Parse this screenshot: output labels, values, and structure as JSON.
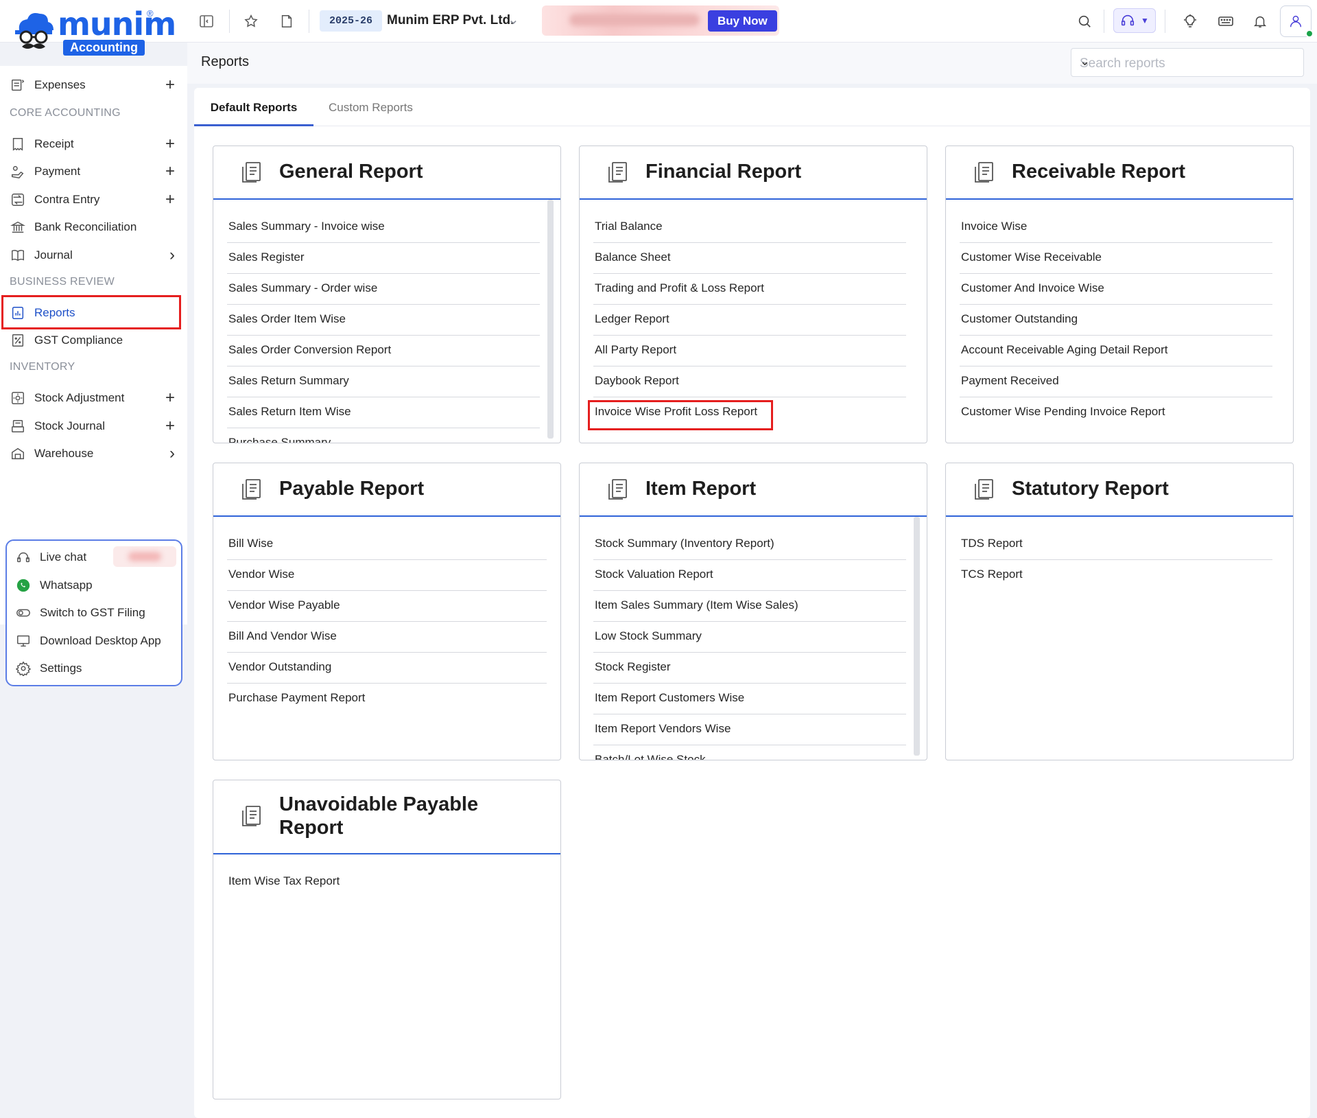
{
  "brand": {
    "name": "munim",
    "registered": "®",
    "tag": "Accounting"
  },
  "topbar": {
    "fiscal_year": "2025-26",
    "company": "Munim ERP Pvt. Ltd.",
    "buy_now": "Buy Now"
  },
  "sidebar": {
    "items": [
      {
        "label": "Expenses",
        "icon": "expenses-icon",
        "trail": "+"
      },
      {
        "label": "Receipt",
        "icon": "receipt-icon",
        "trail": "+"
      },
      {
        "label": "Payment",
        "icon": "payment-icon",
        "trail": "+"
      },
      {
        "label": "Contra Entry",
        "icon": "contra-icon",
        "trail": "+"
      },
      {
        "label": "Bank Reconciliation",
        "icon": "bank-icon",
        "trail": ""
      },
      {
        "label": "Journal",
        "icon": "journal-icon",
        "trail": "›"
      },
      {
        "label": "Reports",
        "icon": "reports-icon",
        "trail": ""
      },
      {
        "label": "GST Compliance",
        "icon": "gst-icon",
        "trail": ""
      },
      {
        "label": "Stock Adjustment",
        "icon": "stock-adjust-icon",
        "trail": "+"
      },
      {
        "label": "Stock Journal",
        "icon": "stock-journal-icon",
        "trail": "+"
      },
      {
        "label": "Warehouse",
        "icon": "warehouse-icon",
        "trail": "›"
      }
    ],
    "headings": {
      "core": "CORE ACCOUNTING",
      "business": "BUSINESS REVIEW",
      "inventory": "INVENTORY"
    },
    "help": [
      {
        "label": "Live chat",
        "icon": "chat-icon"
      },
      {
        "label": "Whatsapp",
        "icon": "whatsapp-icon"
      },
      {
        "label": "Switch to GST Filing",
        "icon": "toggle-icon"
      },
      {
        "label": "Download Desktop App",
        "icon": "desktop-icon"
      },
      {
        "label": "Settings",
        "icon": "settings-icon"
      }
    ]
  },
  "page": {
    "title": "Reports",
    "search_placeholder": "Search reports",
    "tabs": [
      "Default Reports",
      "Custom Reports"
    ]
  },
  "cards": [
    {
      "title": "General Report",
      "rows": [
        "Sales Summary - Invoice wise",
        "Sales Register",
        "Sales Summary - Order wise",
        "Sales Order Item Wise",
        "Sales Order Conversion Report",
        "Sales Return Summary",
        "Sales Return Item Wise",
        "Purchase Summary"
      ]
    },
    {
      "title": "Financial Report",
      "rows": [
        "Trial Balance",
        "Balance Sheet",
        "Trading and Profit & Loss Report",
        "Ledger Report",
        "All Party Report",
        "Daybook Report",
        "Invoice Wise Profit Loss Report"
      ]
    },
    {
      "title": "Receivable Report",
      "rows": [
        "Invoice Wise",
        "Customer Wise Receivable",
        "Customer And Invoice Wise",
        "Customer Outstanding",
        "Account Receivable Aging Detail Report",
        "Payment Received",
        "Customer Wise Pending Invoice Report"
      ]
    },
    {
      "title": "Payable Report",
      "rows": [
        "Bill Wise",
        "Vendor Wise",
        "Vendor Wise Payable",
        "Bill And Vendor Wise",
        "Vendor Outstanding",
        "Purchase Payment Report"
      ]
    },
    {
      "title": "Item Report",
      "rows": [
        "Stock Summary (Inventory Report)",
        "Stock Valuation Report",
        "Item Sales Summary (Item Wise Sales)",
        "Low Stock Summary",
        "Stock Register",
        "Item Report Customers Wise",
        "Item Report Vendors Wise",
        "Batch/Lot Wise Stock"
      ]
    },
    {
      "title": "Statutory Report",
      "rows": [
        "TDS Report",
        "TCS Report"
      ]
    },
    {
      "title": "Unavoidable Payable Report",
      "title_lines": [
        "Unavoidable Payable",
        "Report"
      ],
      "rows": [
        "Item Wise Tax Report"
      ]
    }
  ],
  "colors": {
    "accent": "#1e63e6",
    "highlight": "#e51e1e",
    "card_rule": "#2f63d8"
  }
}
